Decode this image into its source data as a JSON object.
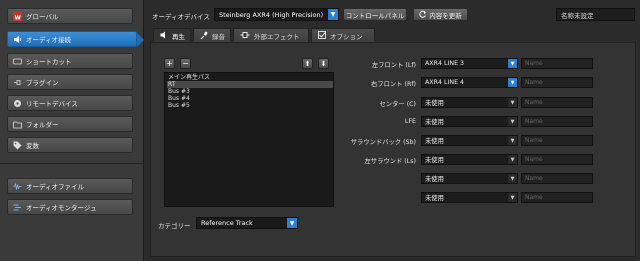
{
  "sidebar": {
    "items": [
      {
        "label": "グローバル",
        "icon": "logo-w-icon",
        "active": false
      },
      {
        "label": "オーディオ接続",
        "icon": "speaker-icon",
        "active": true
      },
      {
        "label": "ショートカット",
        "icon": "keyboard-icon",
        "active": false
      },
      {
        "label": "プラグイン",
        "icon": "plug-icon",
        "active": false
      },
      {
        "label": "リモートデバイス",
        "icon": "knob-icon",
        "active": false
      },
      {
        "label": "フォルダー",
        "icon": "folder-icon",
        "active": false
      },
      {
        "label": "変数",
        "icon": "tag-icon",
        "active": false
      },
      {
        "label": "オーディオファイル",
        "icon": "waveform-icon",
        "active": false
      },
      {
        "label": "オーディオモンタージュ",
        "icon": "montage-icon",
        "active": false
      }
    ]
  },
  "topbar": {
    "device_label": "オーディオデバイス",
    "device_value": "Steinberg AXR4 (High Precision)",
    "control_panel": "コントロールパネル",
    "refresh": "内容を更新",
    "preset_name": "名称未設定"
  },
  "tabs": [
    {
      "label": "再生",
      "icon": "speaker-icon",
      "active": true
    },
    {
      "label": "録音",
      "icon": "mic-icon",
      "active": false
    },
    {
      "label": "外部エフェクト",
      "icon": "fx-icon",
      "active": false
    },
    {
      "label": "オプション",
      "icon": "check-icon",
      "active": false
    }
  ],
  "list": {
    "items": [
      "メイン再生パス",
      "RT",
      "Bus #3",
      "Bus #4",
      "Bus #5"
    ],
    "selected_index": 1,
    "add": "+",
    "remove": "−",
    "up": "⬆",
    "down": "⬇"
  },
  "category": {
    "label": "カテゴリー",
    "value": "Reference Track"
  },
  "routing": {
    "name_placeholder": "Name",
    "rows": [
      {
        "label": "左フロント (Lf)",
        "value": "AXR4 LINE 3",
        "blue": true
      },
      {
        "label": "右フロント (Rf)",
        "value": "AXR4 LINE 4",
        "blue": true
      },
      {
        "label": "センター (C)",
        "value": "未使用",
        "blue": false
      },
      {
        "label": "LFE",
        "value": "未使用",
        "blue": false
      },
      {
        "label": "サラウンドバック (Sb)",
        "value": "未使用",
        "blue": false
      },
      {
        "label": "左サラウンド (Ls)",
        "value": "未使用",
        "blue": false
      },
      {
        "label": "",
        "value": "未使用",
        "blue": false
      },
      {
        "label": "",
        "value": "未使用",
        "blue": false
      }
    ]
  },
  "colors": {
    "accent": "#2f7fd0"
  }
}
